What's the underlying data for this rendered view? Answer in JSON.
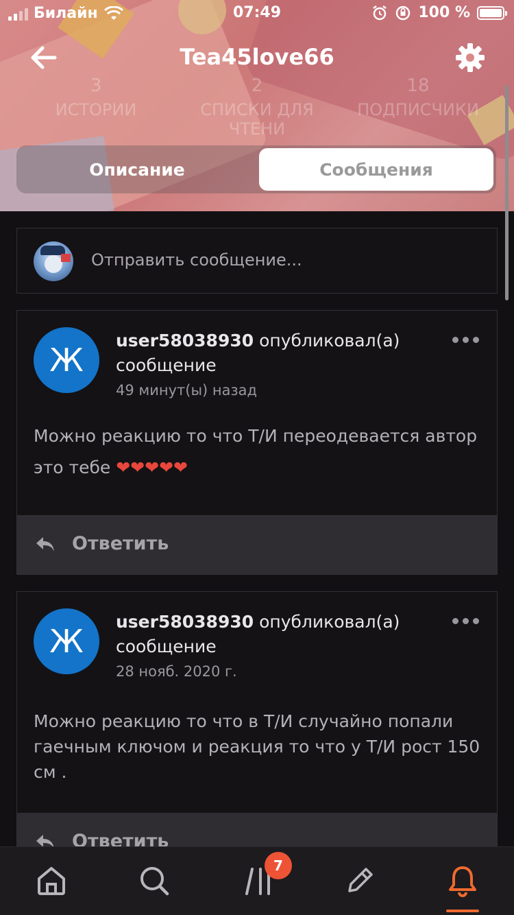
{
  "status_bar": {
    "carrier": "Билайн",
    "time": "07:49",
    "battery": "100 %"
  },
  "nav": {
    "title": "Tea45love66"
  },
  "stats": [
    {
      "count": "3",
      "label": "ИСТОРИИ"
    },
    {
      "count": "2",
      "label": "СПИСКИ ДЛЯ ЧТЕНИ"
    },
    {
      "count": "18",
      "label": "ПОДПИСЧИКИ"
    }
  ],
  "tabs": {
    "description": "Описание",
    "messages": "Сообщения"
  },
  "compose": {
    "placeholder": "Отправить сообщение..."
  },
  "messages": [
    {
      "avatar_letter": "Ж",
      "user": "user58038930",
      "action": "опубликовал(а) сообщение",
      "time": "49 минут(ы) назад",
      "text": "Можно реакцию то что Т/И переодевается автор это тебе",
      "hearts": "❤❤❤❤❤",
      "reply_label": "Ответить"
    },
    {
      "avatar_letter": "Ж",
      "user": "user58038930",
      "action": "опубликовал(а) сообщение",
      "time": "28 нояб. 2020 г.",
      "text": "Можно реакцию то что в Т/И случайно попали гаечным ключом и реакция то что у Т/И рост 150 см .",
      "reply_label": "Ответить"
    }
  ],
  "tabbar": {
    "badge_count": "7",
    "active_tab": "notifications",
    "accent_color": "#ef6a2e"
  },
  "colors": {
    "background": "#121013",
    "avatar_blue": "#1374c9",
    "reply_bar": "#2f2d31"
  }
}
